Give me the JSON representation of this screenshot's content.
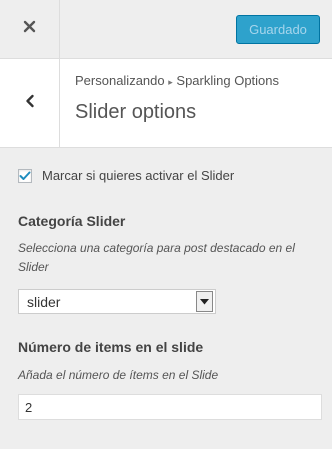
{
  "topbar": {
    "close_icon": "close-icon",
    "saved_label": "Guardado",
    "saved_color": "#2ea2cc"
  },
  "header": {
    "back_icon": "chevron-left-icon",
    "breadcrumb_section": "Personalizando",
    "breadcrumb_separator": "▸",
    "breadcrumb_page": "Sparkling Options",
    "title": "Slider options"
  },
  "controls": {
    "activate_slider": {
      "label": "Marcar si quieres activar el Slider",
      "checked": true
    },
    "slider_category": {
      "title": "Categoría Slider",
      "description": "Selecciona una categoría para post destacado en el Slider",
      "selected": "slider"
    },
    "slide_count": {
      "title": "Número de items en el slide",
      "description": "Añada el número de ítems en el Slide",
      "value": "2"
    }
  }
}
